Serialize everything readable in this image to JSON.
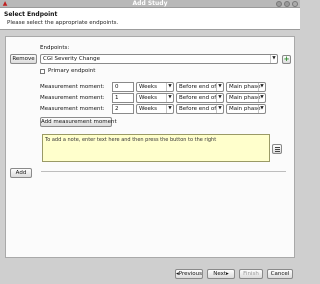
{
  "window": {
    "title": "Add Study",
    "app_icon": "warning-triangle-icon"
  },
  "header": {
    "title": "Select Endpoint",
    "subtitle": "Please select the appropriate endpoints."
  },
  "endpoints": {
    "section_label": "Endpoints:",
    "remove_label": "Remove",
    "selected": "CGI Severity Change",
    "primary_label": "Primary endpoint",
    "primary_checked": false,
    "add_icon": "plus-icon"
  },
  "measurements": [
    {
      "label": "Measurement moment:",
      "value": "0",
      "unit": "Weeks",
      "relation": "Before end of",
      "phase": "Main phase"
    },
    {
      "label": "Measurement moment:",
      "value": "1",
      "unit": "Weeks",
      "relation": "Before end of",
      "phase": "Main phase"
    },
    {
      "label": "Measurement moment:",
      "value": "2",
      "unit": "Weeks",
      "relation": "Before end of",
      "phase": "Main phase"
    }
  ],
  "add_measurement_label": "Add measurement moment",
  "note": {
    "placeholder": "To add a note, enter text here and then press the button to the right",
    "icon": "note-lines-icon"
  },
  "add_label": "Add",
  "footer": {
    "previous_label": "Previous",
    "next_label": "Next",
    "finish_label": "Finish",
    "cancel_label": "Cancel"
  }
}
